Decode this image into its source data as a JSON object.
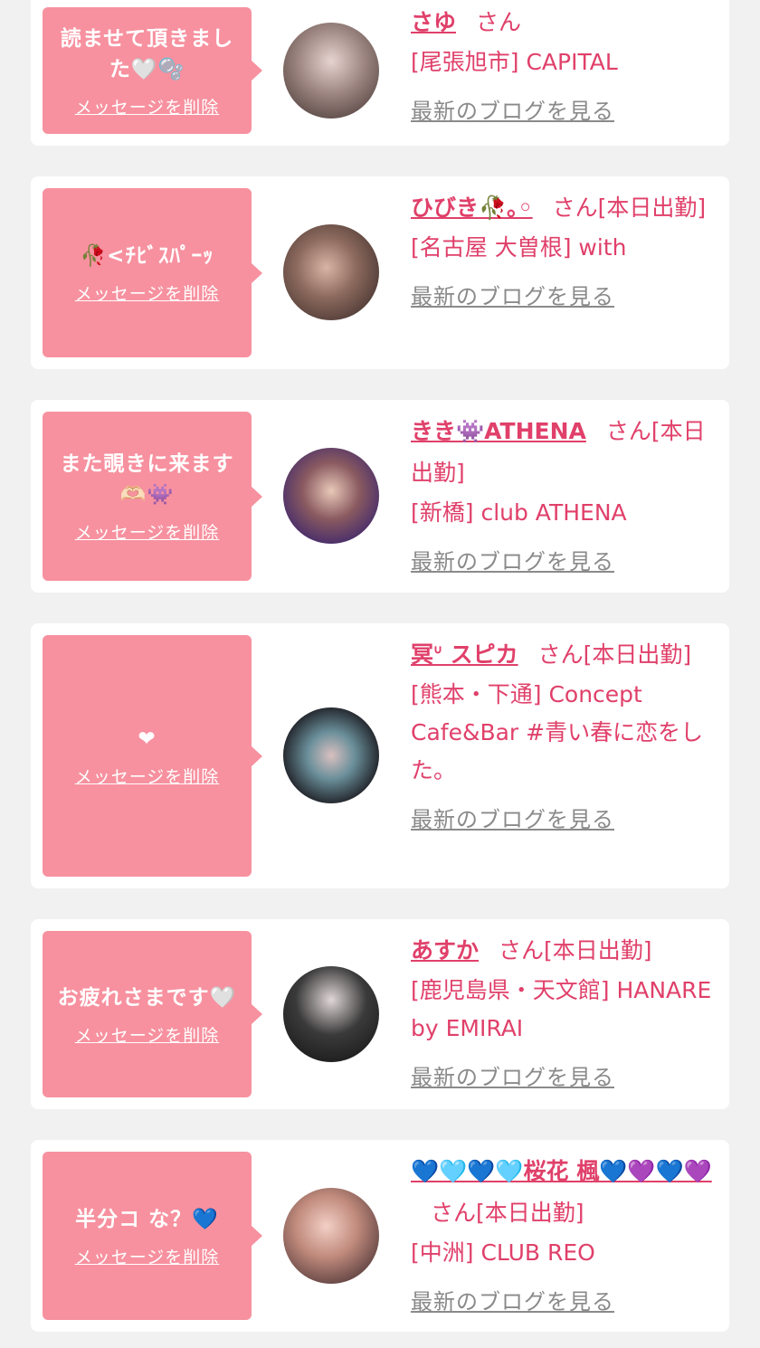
{
  "items": [
    {
      "message": "読ませて頂きました🤍🫧",
      "delete_label": "メッセージを削除",
      "name": "さゆ",
      "suffix": "さん",
      "shop": "[尾張旭市] CAPITAL",
      "blog_label": "最新のブログを見る",
      "avatar_colors": [
        "#6b5a55",
        "#d9c6c2"
      ]
    },
    {
      "message": "🥀<ﾁﾋﾞｽﾊﾟｰｯ",
      "delete_label": "メッセージを削除",
      "name": "ひびき🥀｡◦",
      "suffix": "さん[本日出勤]",
      "shop": "[名古屋 大曽根] with",
      "blog_label": "最新のブログを見る",
      "avatar_colors": [
        "#3a2a24",
        "#c9a595"
      ]
    },
    {
      "message": "また覗きに来ます🫶🏻👾",
      "delete_label": "メッセージを削除",
      "name": "きき👾ATHENA",
      "suffix": "さん[本日出勤]",
      "shop": "[新橋] club ATHENA",
      "blog_label": "最新のブログを見る",
      "avatar_colors": [
        "#5a3f2e",
        "#6a3fa0"
      ]
    },
    {
      "message": "❤︎",
      "delete_label": "メッセージを削除",
      "name": "冥ᐡ スピカ",
      "suffix": "さん[本日出勤]",
      "shop": "[熊本・下通] Concept Cafe&Bar #青い春に恋をした。",
      "blog_label": "最新のブログを見る",
      "avatar_colors": [
        "#222226",
        "#4fa9b8"
      ]
    },
    {
      "message": "お疲れさまです🤍",
      "delete_label": "メッセージを削除",
      "name": "あすか",
      "suffix": "さん[本日出勤]",
      "shop": "[鹿児島県・天文館] HANARE by EMIRAI",
      "blog_label": "最新のブログを見る",
      "avatar_colors": [
        "#1a1a1a",
        "#d8cfcf"
      ]
    },
    {
      "message": "半分コ な？💙",
      "delete_label": "メッセージを削除",
      "name": "💙🩵💙🩵桜花 楓💙💜💙💜",
      "suffix": "さん[本日出勤]",
      "shop": "[中洲] CLUB REO",
      "blog_label": "最新のブログを見る",
      "avatar_colors": [
        "#b07d70",
        "#f0c0b8"
      ]
    }
  ]
}
